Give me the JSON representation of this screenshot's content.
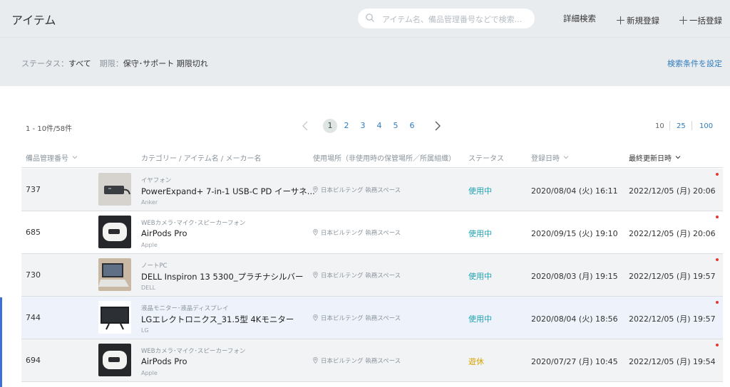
{
  "header": {
    "title": "アイテム",
    "search_placeholder": "アイテム名、備品管理番号などで検索...",
    "advanced_search": "詳細検索",
    "new_label": "新規登録",
    "bulk_label": "一括登録"
  },
  "filters": {
    "status_key": "ステータス：",
    "status_value": "すべて",
    "period_key": "期限：",
    "period_value": "保守･サポート 期限切れ",
    "set_conditions": "検索条件を設定"
  },
  "pagination": {
    "range_text": "1 - 10件/58件",
    "pages": [
      "1",
      "2",
      "3",
      "4",
      "5",
      "6"
    ],
    "current_page": "1",
    "per_page_options": [
      "10",
      "25",
      "100"
    ],
    "per_page_selected": "10"
  },
  "table": {
    "columns": {
      "number": "備品管理番号",
      "item": "カテゴリー / アイテム名 / メーカー名",
      "location": "使用場所（非使用時の保管場所／所属組織）",
      "status": "ステータス",
      "registered": "登録日時",
      "updated": "最終更新日時"
    },
    "rows": [
      {
        "number": "737",
        "category": "イヤフォン",
        "name": "PowerExpand+ 7-in-1 USB-C PD イーサネ...",
        "maker": "Anker",
        "location": "日本ビルテング 執務スペース",
        "status": "使用中",
        "registered": "2020/08/04 (火) 16:11",
        "updated": "2022/12/05 (月) 20:06"
      },
      {
        "number": "685",
        "category": "WEBカメラ･マイク･スピーカーフォン",
        "name": "AirPods Pro",
        "maker": "Apple",
        "location": "日本ビルテング 執務スペース",
        "status": "使用中",
        "registered": "2020/09/15 (火) 19:10",
        "updated": "2022/12/05 (月) 20:06"
      },
      {
        "number": "730",
        "category": "ノートPC",
        "name": "DELL Inspiron 13 5300_プラチナシルバー",
        "maker": "DELL",
        "location": "日本ビルテング 執務スペース",
        "status": "使用中",
        "registered": "2020/08/03 (月) 19:15",
        "updated": "2022/12/05 (月) 19:57"
      },
      {
        "number": "744",
        "category": "液晶モニター･液晶ディスプレイ",
        "name": "LGエレクトロニクス_31.5型 4Kモニター",
        "maker": "LG",
        "location": "日本ビルテング 執務スペース",
        "status": "使用中",
        "registered": "2020/08/04 (火) 18:56",
        "updated": "2022/12/05 (月) 19:57"
      },
      {
        "number": "694",
        "category": "WEBカメラ･マイク･スピーカーフォン",
        "name": "AirPods Pro",
        "maker": "Apple",
        "location": "日本ビルテング 執務スペース",
        "status": "遊休",
        "registered": "2020/07/27 (月) 10:45",
        "updated": "2022/12/05 (月) 19:54"
      }
    ]
  },
  "colors": {
    "in_use": "#1ea2b4",
    "idle": "#d9a400",
    "link": "#2f7cc0",
    "new_dot": "#e53935",
    "selected_row": "#eef3fb",
    "striped_row": "#f2f3f5"
  }
}
